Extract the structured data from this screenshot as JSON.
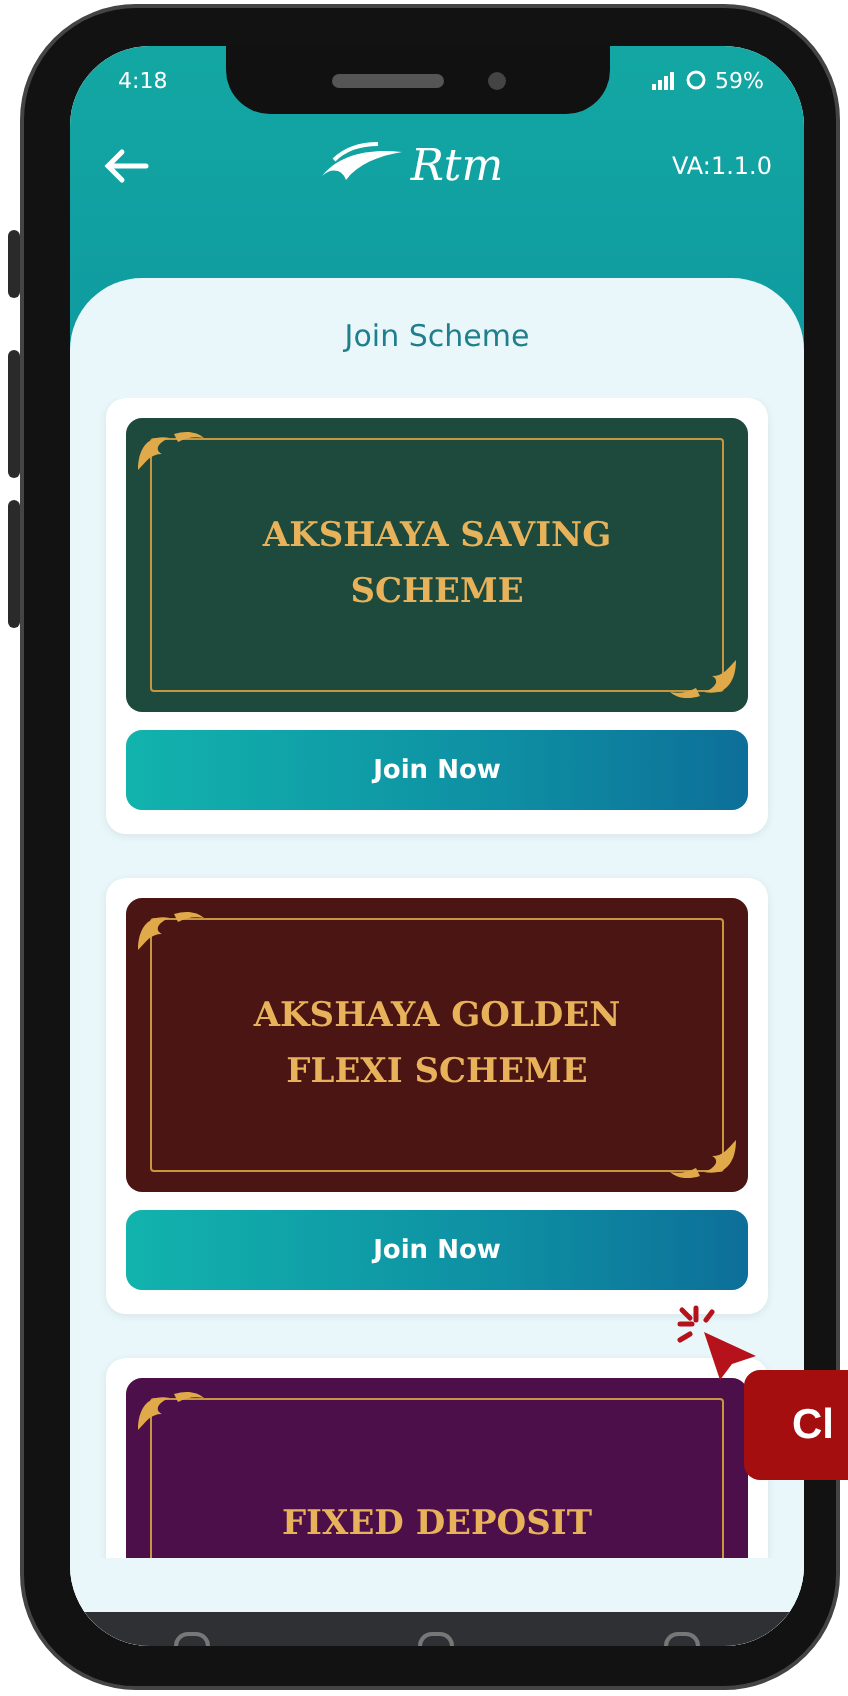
{
  "status_bar": {
    "time": "4:18",
    "battery": "59%"
  },
  "header": {
    "logo_text": "Rtm",
    "version": "VA:1.1.0"
  },
  "title": "Join Scheme",
  "schemes": [
    {
      "title": "AKSHAYA SAVING SCHEME",
      "color": "#1d4a3c",
      "button": "Join Now"
    },
    {
      "title": "AKSHAYA GOLDEN FLEXI SCHEME",
      "color": "#4a1512",
      "button": "Join Now"
    },
    {
      "title": "FIXED DEPOSIT",
      "color": "#4d0f4a"
    }
  ],
  "overlay_label": "Cl"
}
